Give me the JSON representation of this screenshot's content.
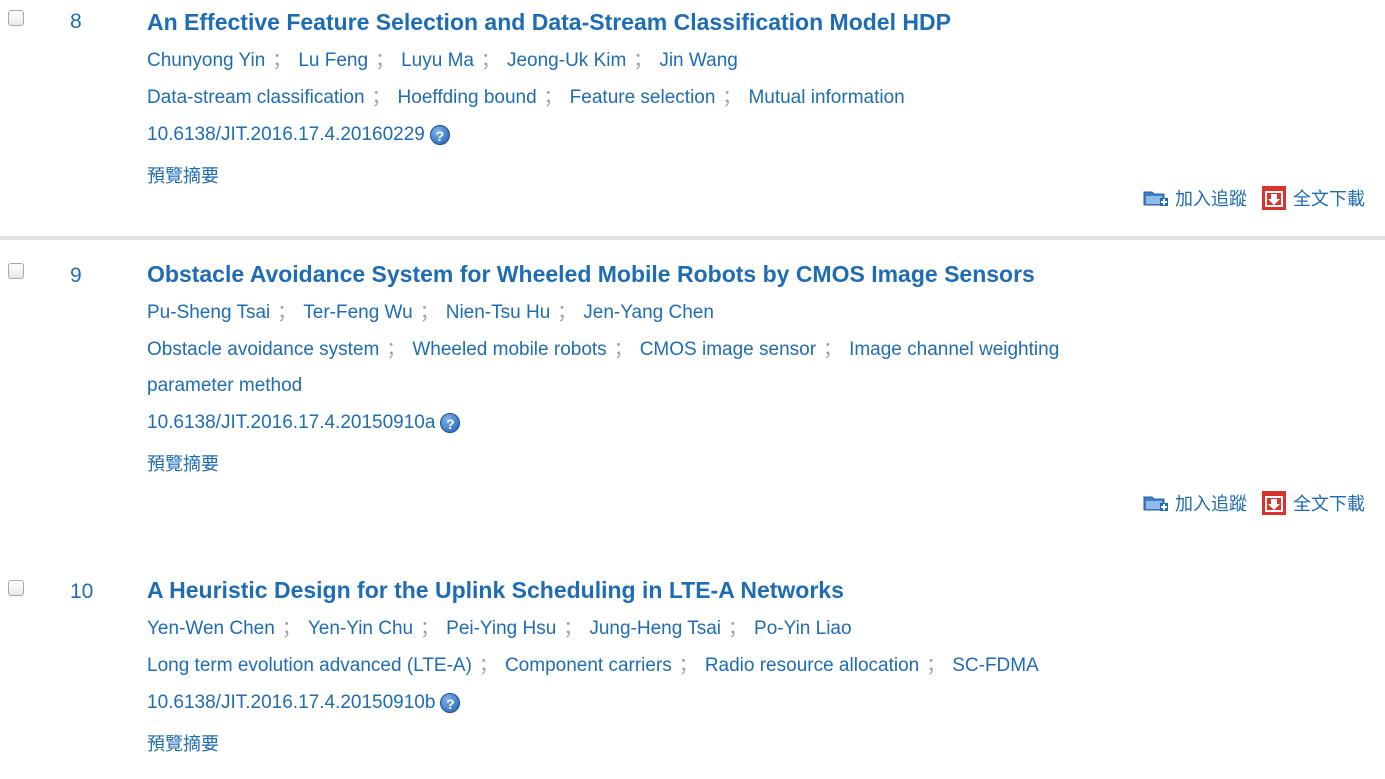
{
  "results": [
    {
      "number": "8",
      "title": "An Effective Feature Selection and Data-Stream Classification Model HDP",
      "authors": [
        "Chunyong Yin",
        "Lu Feng",
        "Luyu Ma",
        "Jeong-Uk Kim",
        "Jin Wang"
      ],
      "keywords_line1": [
        "Data-stream classification",
        "Hoeffding bound",
        "Feature selection",
        "Mutual information"
      ],
      "keywords_line2": "",
      "doi": "10.6138/JIT.2016.17.4.20160229",
      "preview_label": "預覽摘要",
      "track_label": "加入追蹤",
      "download_label": "全文下載"
    },
    {
      "number": "9",
      "title": "Obstacle Avoidance System for Wheeled Mobile Robots by CMOS Image Sensors",
      "authors": [
        "Pu-Sheng Tsai",
        "Ter-Feng Wu",
        "Nien-Tsu Hu",
        "Jen-Yang Chen"
      ],
      "keywords_line1": [
        "Obstacle avoidance system",
        "Wheeled mobile robots",
        "CMOS image sensor",
        "Image channel weighting"
      ],
      "keywords_line2": "parameter method",
      "doi": "10.6138/JIT.2016.17.4.20150910a",
      "preview_label": "預覽摘要",
      "track_label": "加入追蹤",
      "download_label": "全文下載"
    },
    {
      "number": "10",
      "title": "A Heuristic Design for the Uplink Scheduling in LTE-A Networks",
      "authors": [
        "Yen-Wen Chen",
        "Yen-Yin Chu",
        "Pei-Ying Hsu",
        "Jung-Heng Tsai",
        "Po-Yin Liao"
      ],
      "keywords_line1": [
        "Long term evolution advanced (LTE-A)",
        "Component carriers",
        "Radio resource allocation",
        "SC-FDMA"
      ],
      "keywords_line2": "",
      "doi": "10.6138/JIT.2016.17.4.20150910b",
      "preview_label": "預覽摘要"
    }
  ],
  "separator": "；",
  "help_glyph": "?",
  "colors": {
    "link": "#1e6cb4",
    "separator": "#9aa0a6",
    "divider": "#e3e3e3",
    "download_red": "#d9342b"
  }
}
